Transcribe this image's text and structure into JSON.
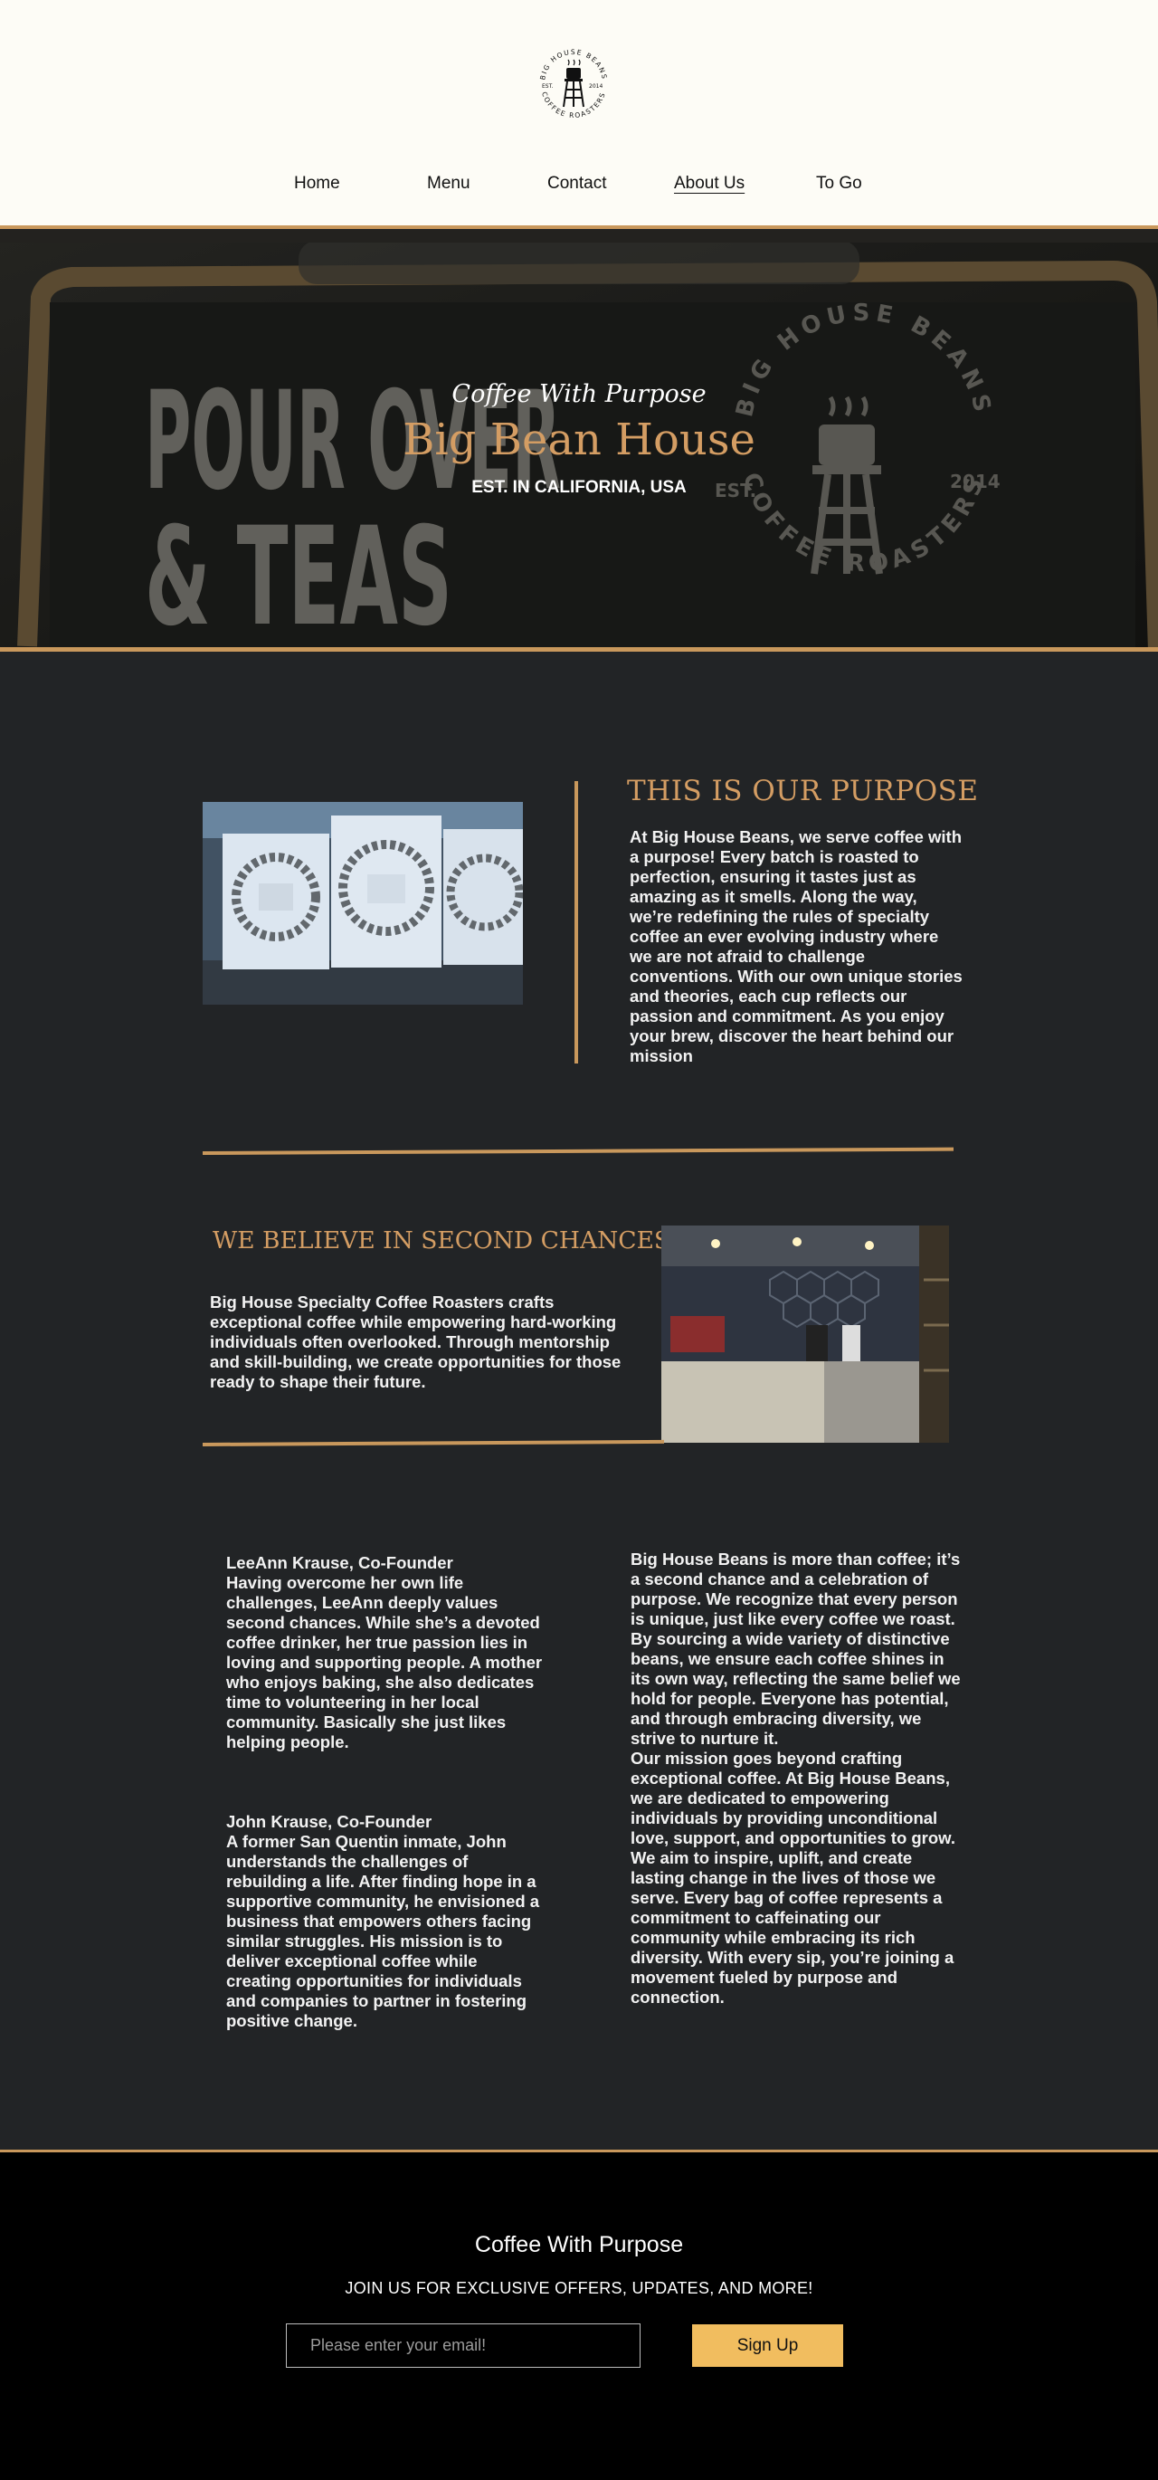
{
  "brand": {
    "logo_text_top": "BIG HOUSE BEANS",
    "logo_text_bottom": "COFFEE ROASTERS",
    "logo_est": "EST.",
    "logo_year": "2014"
  },
  "nav": {
    "items": [
      {
        "label": "Home"
      },
      {
        "label": "Menu"
      },
      {
        "label": "Contact"
      },
      {
        "label": "About Us",
        "active": true
      },
      {
        "label": "To Go"
      }
    ]
  },
  "hero": {
    "tagline": "Coffee With Purpose",
    "title": "Big Bean House",
    "established": "EST. IN CALIFORNIA, USA",
    "sign_line1": "POUR OVER",
    "sign_line2": "& TEAS",
    "seal_top": "BIG HOUSE BEANS",
    "seal_bottom": "COFFEE ROASTERS",
    "seal_year": "2014",
    "seal_est": "EST."
  },
  "purpose": {
    "title": "THIS IS OUR PURPOSE",
    "body": "At Big House Beans, we serve coffee with a purpose! Every batch is roasted to perfection, ensuring it tastes just as amazing as it smells. Along the way, we’re redefining the rules of specialty coffee an ever evolving industry where we are not afraid to challenge conventions. With our own unique stories and theories, each cup reflects our passion and commitment. As you enjoy your brew, discover the heart behind our mission"
  },
  "second_chances": {
    "title": "WE BELIEVE IN SECOND CHANCES.",
    "body": "Big House Specialty Coffee Roasters crafts exceptional coffee while empowering hard-working individuals often overlooked. Through mentorship and skill-building, we create opportunities for those ready to shape their future."
  },
  "founders": [
    {
      "name": "LeeAnn Krause, Co-Founder",
      "bio": "Having overcome her own life challenges, LeeAnn deeply values second chances. While she’s a devoted coffee drinker, her true passion lies in loving and supporting people. A mother who enjoys baking, she also dedicates time to volunteering in her local community. Basically she just likes helping people."
    },
    {
      "name": "John Krause, Co-Founder",
      "bio": "A former San Quentin inmate, John understands the challenges of rebuilding a life. After finding hope in a supportive community, he envisioned a business that empowers others facing similar struggles. His mission is to deliver exceptional coffee while creating opportunities for individuals and companies to partner in fostering positive change."
    }
  ],
  "about": {
    "paragraph1": "Big House Beans is more than coffee; it’s a second chance and a celebration of purpose. We recognize that every person is unique, just like every coffee we roast. By sourcing a wide variety of distinctive beans, we ensure each coffee shines in its own way, reflecting the same belief we hold for people. Everyone has potential, and through embracing diversity, we strive to nurture it.",
    "paragraph2": "Our mission goes beyond crafting exceptional coffee. At Big House Beans, we are dedicated to empowering individuals by providing unconditional love, support, and opportunities to grow. We aim to inspire, uplift, and create lasting change in the lives of those we serve. Every bag of coffee represents a commitment to caffeinating our community while embracing its rich diversity. With every sip, you’re joining a movement fueled by purpose and connection."
  },
  "footer": {
    "title": "Coffee With Purpose",
    "subtitle": "JOIN US FOR EXCLUSIVE OFFERS, UPDATES, AND MORE!",
    "email_placeholder": "Please enter your email!",
    "signup_label": "Sign Up"
  },
  "colors": {
    "accent": "#c9985c",
    "heading_gold": "#d49d63",
    "background": "#222426",
    "header_bg": "#fdfcf6",
    "button": "#f1bd5f"
  }
}
